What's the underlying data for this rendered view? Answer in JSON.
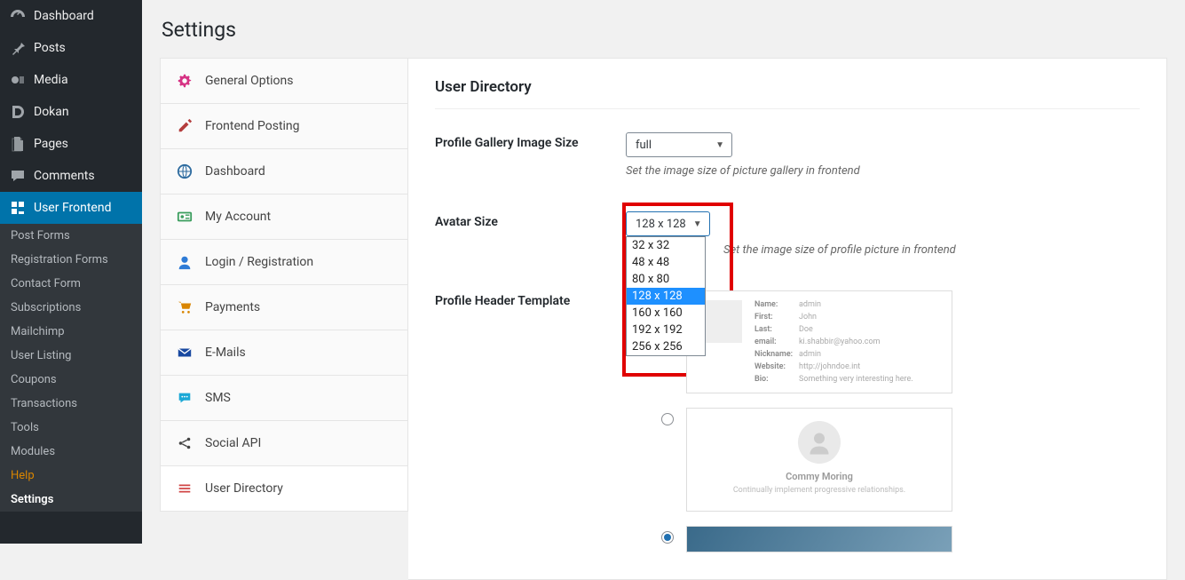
{
  "page": {
    "title": "Settings"
  },
  "sidebar": {
    "items": [
      {
        "label": "Dashboard",
        "icon": "gauge-icon"
      },
      {
        "label": "Posts",
        "icon": "pin-icon"
      },
      {
        "label": "Media",
        "icon": "media-icon"
      },
      {
        "label": "Dokan",
        "icon": "dokan-icon"
      },
      {
        "label": "Pages",
        "icon": "pages-icon"
      },
      {
        "label": "Comments",
        "icon": "comment-icon"
      },
      {
        "label": "User Frontend",
        "icon": "user-frontend-icon"
      }
    ],
    "sub": [
      {
        "label": "Post Forms"
      },
      {
        "label": "Registration Forms"
      },
      {
        "label": "Contact Form"
      },
      {
        "label": "Subscriptions"
      },
      {
        "label": "Mailchimp"
      },
      {
        "label": "User Listing"
      },
      {
        "label": "Coupons"
      },
      {
        "label": "Transactions"
      },
      {
        "label": "Tools"
      },
      {
        "label": "Modules"
      },
      {
        "label": "Help"
      },
      {
        "label": "Settings"
      }
    ]
  },
  "tabs": [
    {
      "label": "General Options",
      "icon": "gear-icon",
      "color": "#d63384"
    },
    {
      "label": "Frontend Posting",
      "icon": "edit-icon",
      "color": "#b43d3d"
    },
    {
      "label": "Dashboard",
      "icon": "globe-icon",
      "color": "#2d6b9f"
    },
    {
      "label": "My Account",
      "icon": "id-card-icon",
      "color": "#3a9d5d"
    },
    {
      "label": "Login / Registration",
      "icon": "user-icon",
      "color": "#2e7bd6"
    },
    {
      "label": "Payments",
      "icon": "cart-icon",
      "color": "#d98500"
    },
    {
      "label": "E-Mails",
      "icon": "mail-icon",
      "color": "#1848a0"
    },
    {
      "label": "SMS",
      "icon": "sms-icon",
      "color": "#1ba8d6"
    },
    {
      "label": "Social API",
      "icon": "share-icon",
      "color": "#444"
    },
    {
      "label": "User Directory",
      "icon": "list-icon",
      "color": "#d04545"
    }
  ],
  "panel": {
    "section_title": "User Directory",
    "gallery_label": "Profile Gallery Image Size",
    "gallery_value": "full",
    "gallery_help": "Set the image size of picture gallery in frontend",
    "avatar_label": "Avatar Size",
    "avatar_value": "128 x 128",
    "avatar_help": "Set the image size of profile picture in frontend",
    "avatar_options": [
      "32 x 32",
      "48 x 48",
      "80 x 80",
      "128 x 128",
      "160 x 160",
      "192 x 192",
      "256 x 256"
    ],
    "template_label": "Profile Header Template",
    "thumb1": {
      "rows": [
        {
          "k": "Name:",
          "v": "admin"
        },
        {
          "k": "First:",
          "v": "John"
        },
        {
          "k": "Last:",
          "v": "Doe"
        },
        {
          "k": "email:",
          "v": "ki.shabbir@yahoo.com"
        },
        {
          "k": "Nickname:",
          "v": "admin"
        },
        {
          "k": "Website:",
          "v": "http://johndoe.int"
        },
        {
          "k": "Bio:",
          "v": "Something very interesting here."
        }
      ]
    },
    "thumb2": {
      "name": "Commy Moring",
      "desc": "Continually implement progressive relationships."
    }
  }
}
